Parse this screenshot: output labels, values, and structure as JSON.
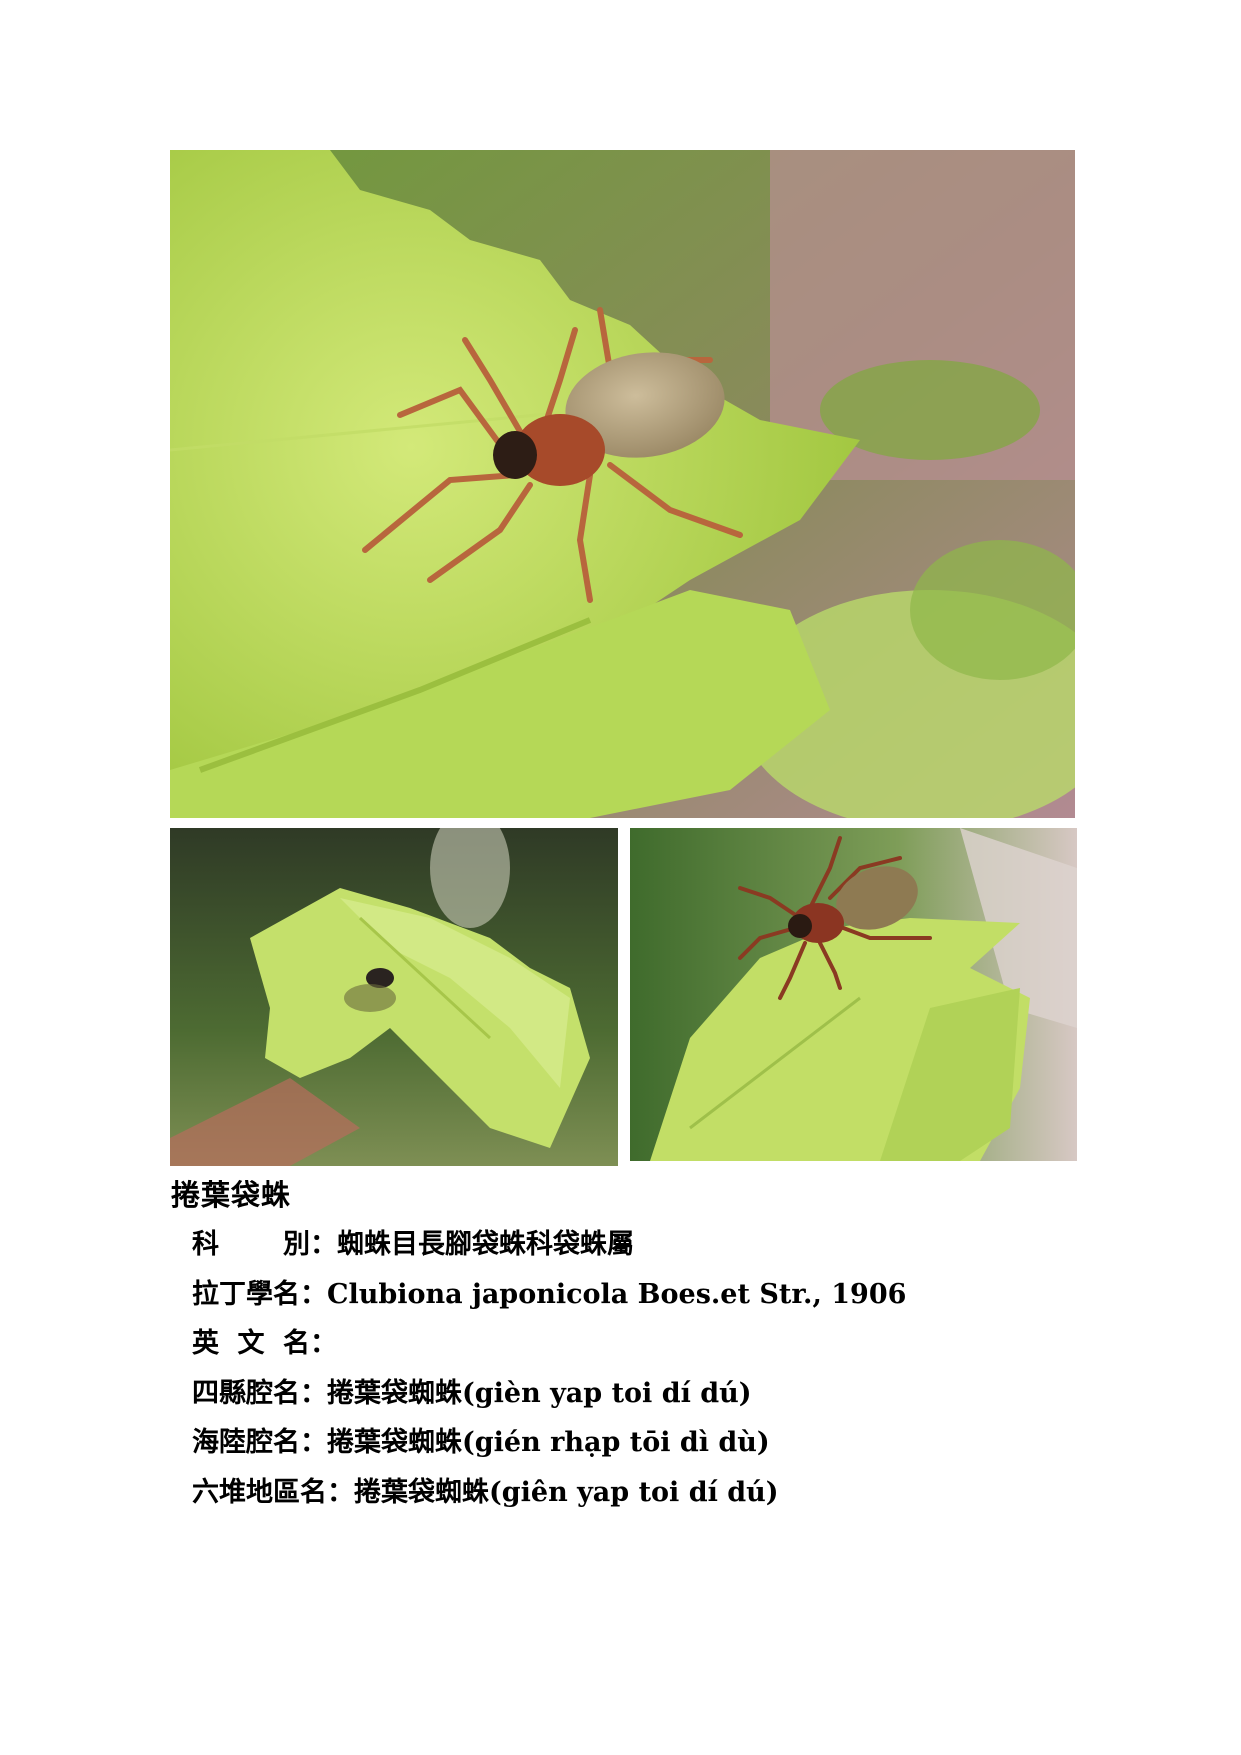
{
  "photos": [
    {
      "subject": "spider on leaf, close-up"
    },
    {
      "subject": "spider hiding in rolled leaf"
    },
    {
      "subject": "spider on leaf edge"
    }
  ],
  "species": {
    "title": "捲葉袋蛛",
    "fields": [
      {
        "label": "科　別",
        "label_chars": [
          "科",
          "別"
        ],
        "colon": "：",
        "value": "蜘蛛目長腳袋蛛科袋蛛屬"
      },
      {
        "label": "拉丁學名",
        "colon": "：",
        "value": "Clubiona japonicola Boes.et Str., 1906"
      },
      {
        "label": "英 文 名",
        "label_chars": [
          "英",
          "文",
          "名"
        ],
        "colon": "：",
        "value": ""
      },
      {
        "label": "四縣腔名",
        "colon": "：",
        "value": "捲葉袋蜘蛛(gièn yap toi dí dú)"
      },
      {
        "label": "海陸腔名",
        "colon": "：",
        "value": "捲葉袋蜘蛛(gién rhạp tōi dì dù)"
      },
      {
        "label": "六堆地區名",
        "colon": "：",
        "value": "捲葉袋蜘蛛(giên yap toi dí dú)"
      }
    ]
  },
  "colors": {
    "leaf_light": "#c9e36a",
    "leaf_mid": "#a7cf45",
    "spider_body": "#b5502e",
    "spider_abdomen": "#b9a986"
  }
}
